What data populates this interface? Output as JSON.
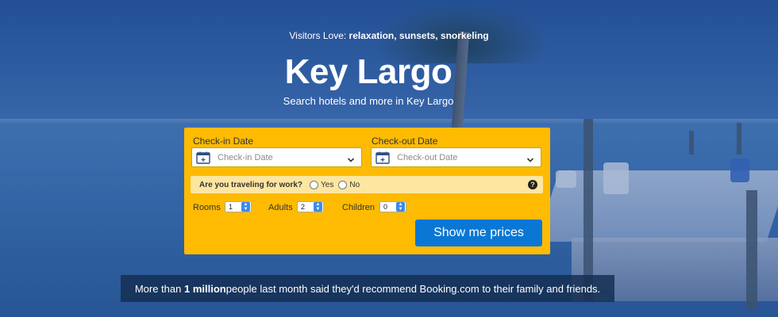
{
  "hero": {
    "visitors_prefix": "Visitors Love: ",
    "visitors_items": "relaxation, sunsets, snorkeling",
    "title": "Key Largo",
    "subtitle": "Search hotels and more in Key Largo"
  },
  "search": {
    "checkin_label": "Check-in Date",
    "checkin_placeholder": "Check-in Date",
    "checkout_label": "Check-out Date",
    "checkout_placeholder": "Check-out Date",
    "work_question": "Are you traveling for work?",
    "work_yes": "Yes",
    "work_no": "No",
    "help_symbol": "?",
    "rooms_label": "Rooms",
    "rooms_value": "1",
    "adults_label": "Adults",
    "adults_value": "2",
    "children_label": "Children",
    "children_value": "0",
    "submit_label": "Show me prices"
  },
  "banner": {
    "prefix": "More than ",
    "highlight": "1 million",
    "suffix": " people last month said they'd recommend Booking.com to their family and friends."
  },
  "colors": {
    "search_bg": "#febb02",
    "work_row_bg": "#fde6a0",
    "button_bg": "#0a77d5",
    "banner_bg": "#142d50"
  },
  "icons": [
    "calendar-icon",
    "chevron-down-icon",
    "help-icon"
  ]
}
